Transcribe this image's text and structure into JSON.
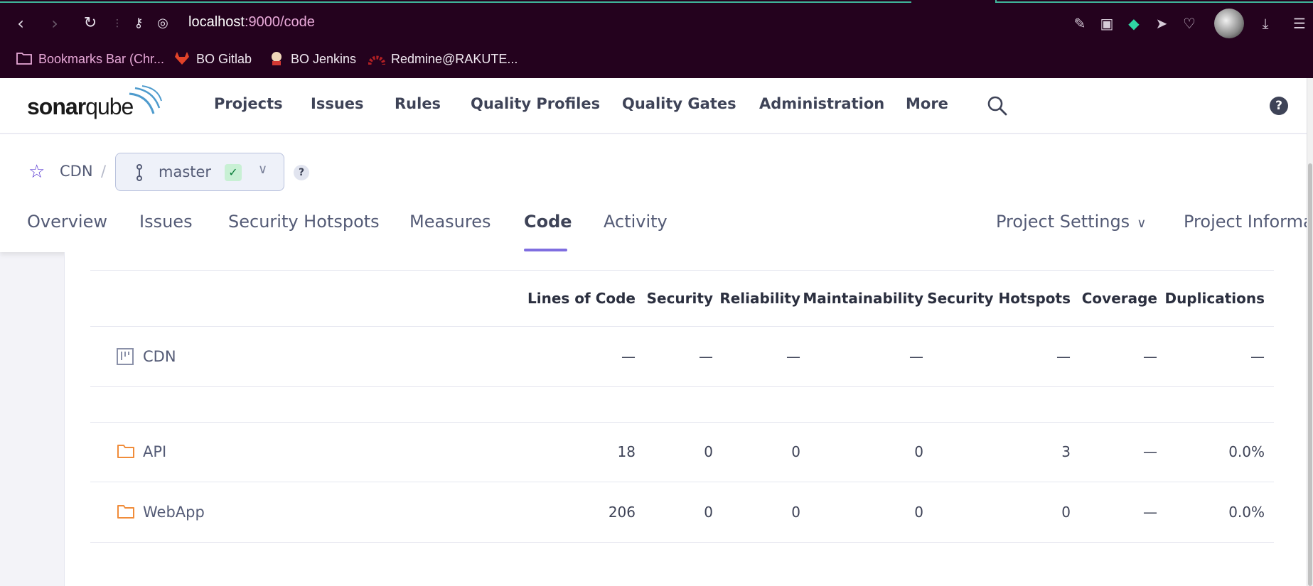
{
  "browser": {
    "url_host": "localhost",
    "url_path": ":9000/code",
    "bookmarks": [
      {
        "label": "Bookmarks Bar (Chr..."
      },
      {
        "label": "BO Gitlab"
      },
      {
        "label": "BO Jenkins"
      },
      {
        "label": "Redmine@RAKUTE..."
      }
    ]
  },
  "sonarqube": {
    "logo_bold": "sonar",
    "logo_light": "qube",
    "nav": [
      "Projects",
      "Issues",
      "Rules",
      "Quality Profiles",
      "Quality Gates",
      "Administration",
      "More"
    ]
  },
  "project": {
    "name": "CDN",
    "separator": "/",
    "branch": "master",
    "help": "?",
    "tabs": [
      "Overview",
      "Issues",
      "Security Hotspots",
      "Measures",
      "Code",
      "Activity"
    ],
    "active_tab": "Code",
    "settings_label": "Project Settings",
    "info_label": "Project Informa"
  },
  "table": {
    "columns": [
      "Lines of Code",
      "Security",
      "Reliability",
      "Maintainability",
      "Security Hotspots",
      "Coverage",
      "Duplications"
    ],
    "root": {
      "name": "CDN",
      "values": [
        "—",
        "—",
        "—",
        "—",
        "—",
        "—",
        "—"
      ]
    },
    "rows": [
      {
        "name": "API",
        "values": [
          "18",
          "0",
          "0",
          "0",
          "3",
          "—",
          "0.0%"
        ]
      },
      {
        "name": "WebApp",
        "values": [
          "206",
          "0",
          "0",
          "0",
          "0",
          "—",
          "0.0%"
        ]
      }
    ]
  },
  "colors": {
    "accent": "#7f6ee0",
    "star": "#5d3fd3",
    "folder": "#f08c3a",
    "browser_bg": "#24021e"
  }
}
